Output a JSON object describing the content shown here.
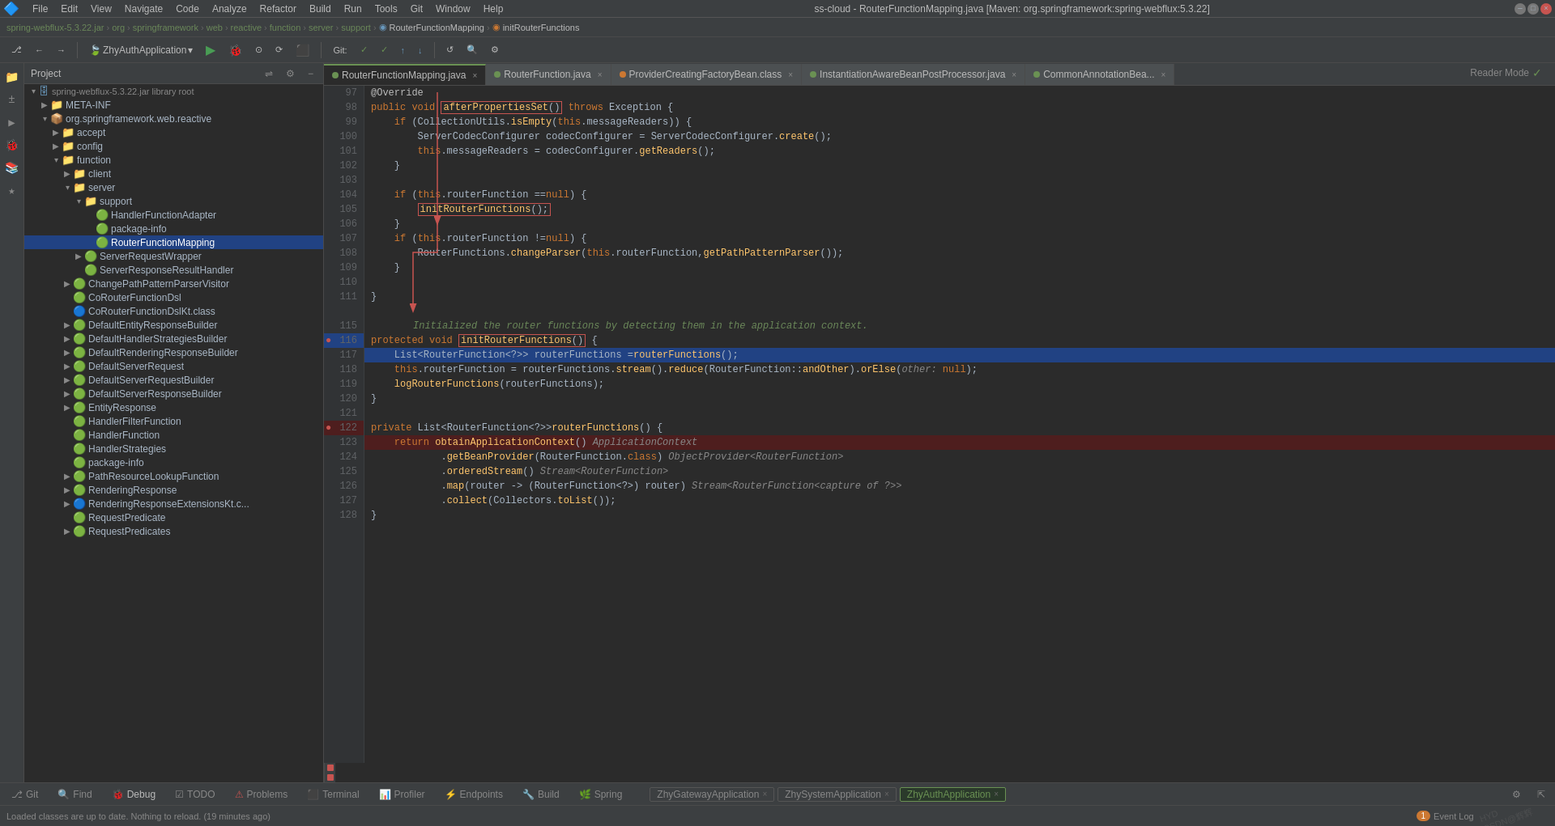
{
  "window": {
    "title": "ss-cloud - RouterFunctionMapping.java [Maven: org.springframework:spring-webflux:5.3.22]",
    "menu_items": [
      "File",
      "Edit",
      "View",
      "Navigate",
      "Code",
      "Analyze",
      "Refactor",
      "Build",
      "Run",
      "Tools",
      "Git",
      "Window",
      "Help"
    ]
  },
  "breadcrumb": {
    "items": [
      "spring-webflux-5.3.22.jar",
      "org",
      "springframework",
      "web",
      "reactive",
      "function",
      "server",
      "support",
      "RouterFunctionMapping",
      "initRouterFunctions"
    ]
  },
  "toolbar": {
    "run_config": "ZhyAuthApplication",
    "git_label": "Git:"
  },
  "project_panel": {
    "title": "Project",
    "tree": [
      {
        "level": 0,
        "label": "spring-webflux-5.3.22.jar library root",
        "type": "lib",
        "expanded": true
      },
      {
        "level": 1,
        "label": "META-INF",
        "type": "folder",
        "expanded": false
      },
      {
        "level": 1,
        "label": "org.springframework.web.reactive",
        "type": "package",
        "expanded": true
      },
      {
        "level": 2,
        "label": "accept",
        "type": "folder",
        "expanded": false
      },
      {
        "level": 2,
        "label": "config",
        "type": "folder",
        "expanded": false
      },
      {
        "level": 2,
        "label": "function",
        "type": "folder",
        "expanded": true
      },
      {
        "level": 3,
        "label": "client",
        "type": "folder",
        "expanded": false
      },
      {
        "level": 3,
        "label": "server",
        "type": "folder",
        "expanded": true
      },
      {
        "level": 4,
        "label": "support",
        "type": "folder",
        "expanded": true
      },
      {
        "level": 5,
        "label": "HandlerFunctionAdapter",
        "type": "java"
      },
      {
        "level": 5,
        "label": "package-info",
        "type": "java"
      },
      {
        "level": 5,
        "label": "RouterFunctionMapping",
        "type": "java",
        "selected": true
      },
      {
        "level": 4,
        "label": "ServerRequestWrapper",
        "type": "java"
      },
      {
        "level": 4,
        "label": "ServerResponseResultHandler",
        "type": "java"
      },
      {
        "level": 3,
        "label": "ChangePathPatternParserVisitor",
        "type": "java"
      },
      {
        "level": 3,
        "label": "CoRouterFunctionDsl",
        "type": "java"
      },
      {
        "level": 3,
        "label": "CoRouterFunctionDslKt.class",
        "type": "class"
      },
      {
        "level": 3,
        "label": "DefaultEntityResponseBuilder",
        "type": "java"
      },
      {
        "level": 3,
        "label": "DefaultHandlerStrategiesBuilder",
        "type": "java"
      },
      {
        "level": 3,
        "label": "DefaultRenderingResponseBuilder",
        "type": "java"
      },
      {
        "level": 3,
        "label": "DefaultServerRequest",
        "type": "java"
      },
      {
        "level": 3,
        "label": "DefaultServerRequestBuilder",
        "type": "java"
      },
      {
        "level": 3,
        "label": "DefaultServerResponseBuilder",
        "type": "java"
      },
      {
        "level": 3,
        "label": "EntityResponse",
        "type": "java"
      },
      {
        "level": 3,
        "label": "HandlerFilterFunction",
        "type": "java"
      },
      {
        "level": 3,
        "label": "HandlerFunction",
        "type": "java"
      },
      {
        "level": 3,
        "label": "HandlerStrategies",
        "type": "java"
      },
      {
        "level": 3,
        "label": "package-info",
        "type": "java"
      },
      {
        "level": 3,
        "label": "PathResourceLookupFunction",
        "type": "java"
      },
      {
        "level": 3,
        "label": "RenderingResponse",
        "type": "java"
      },
      {
        "level": 3,
        "label": "RenderingResponseExtensionsKt.c...",
        "type": "class"
      },
      {
        "level": 3,
        "label": "RequestPredicate",
        "type": "java"
      },
      {
        "level": 3,
        "label": "RequestPredicates",
        "type": "java"
      }
    ]
  },
  "tabs": [
    {
      "label": "RouterFunctionMapping.java",
      "active": true,
      "dot": "green"
    },
    {
      "label": "RouterFunction.java",
      "active": false,
      "dot": "green"
    },
    {
      "label": "ProviderCreatingFactoryBean.class",
      "active": false,
      "dot": "orange"
    },
    {
      "label": "InstantiationAwareBeanPostProcessor.java",
      "active": false,
      "dot": "green"
    },
    {
      "label": "CommonAnnotationBea...",
      "active": false,
      "dot": "green"
    }
  ],
  "code": {
    "reader_mode_label": "Reader Mode",
    "annotation": "@Override",
    "lines": [
      {
        "num": 97,
        "content": "public void afterPropertiesSet() throws Exception {",
        "has_box": true,
        "box_text": "afterPropertiesSet()",
        "breakpoint": false,
        "highlighted": false
      },
      {
        "num": 98,
        "content": "    if (CollectionUtils.isEmpty(this.messageReaders)) {",
        "breakpoint": false,
        "highlighted": false
      },
      {
        "num": 99,
        "content": "        ServerCodecConfigurer codecConfigurer = ServerCodecConfigurer.create();",
        "breakpoint": false,
        "highlighted": false
      },
      {
        "num": 100,
        "content": "        this.messageReaders = codecConfigurer.getReaders();",
        "breakpoint": false,
        "highlighted": false
      },
      {
        "num": 101,
        "content": "    }",
        "breakpoint": false,
        "highlighted": false
      },
      {
        "num": 102,
        "content": "",
        "breakpoint": false,
        "highlighted": false
      },
      {
        "num": 103,
        "content": "    if (this.routerFunction == null) {",
        "breakpoint": false,
        "highlighted": false
      },
      {
        "num": 104,
        "content": "        initRouterFunctions();",
        "has_box": true,
        "box_text": "initRouterFunctions();",
        "breakpoint": false,
        "highlighted": false
      },
      {
        "num": 105,
        "content": "    }",
        "breakpoint": false,
        "highlighted": false
      },
      {
        "num": 106,
        "content": "    if (this.routerFunction != null) {",
        "breakpoint": false,
        "highlighted": false
      },
      {
        "num": 107,
        "content": "        RouterFunctions.changeParser(this.routerFunction, getPathPatternParser());",
        "breakpoint": false,
        "highlighted": false
      },
      {
        "num": 108,
        "content": "    }",
        "breakpoint": false,
        "highlighted": false
      },
      {
        "num": 109,
        "content": "",
        "breakpoint": false,
        "highlighted": false
      },
      {
        "num": 110,
        "content": "}",
        "breakpoint": false,
        "highlighted": false
      },
      {
        "num": 111,
        "content": "",
        "breakpoint": false,
        "highlighted": false
      },
      {
        "num": "",
        "content": "    Initialized the router functions by detecting them in the application context.",
        "is_comment": true
      },
      {
        "num": 115,
        "content": "protected void initRouterFunctions() {",
        "has_box": true,
        "box_text": "initRouterFunctions()",
        "breakpoint": false,
        "highlighted": false
      },
      {
        "num": 116,
        "content": "    List<RouterFunction<?>> routerFunctions = routerFunctions();",
        "breakpoint": true,
        "highlighted": true
      },
      {
        "num": 117,
        "content": "    this.routerFunction = routerFunctions.stream().reduce(RouterFunction::andOther).orElse( other: null);",
        "breakpoint": false,
        "highlighted": false
      },
      {
        "num": 118,
        "content": "    logRouterFunctions(routerFunctions);",
        "breakpoint": false,
        "highlighted": false
      },
      {
        "num": 119,
        "content": "}",
        "breakpoint": false,
        "highlighted": false
      },
      {
        "num": 120,
        "content": "",
        "breakpoint": false,
        "highlighted": false
      },
      {
        "num": 121,
        "content": "private List<RouterFunction<?>> routerFunctions() {",
        "breakpoint": false,
        "highlighted": false
      },
      {
        "num": 122,
        "content": "    return obtainApplicationContext()  ApplicationContext",
        "breakpoint": true,
        "highlighted": false,
        "error": true
      },
      {
        "num": 123,
        "content": "            .getBeanProvider(RouterFunction.class)  ObjectProvider<RouterFunction>",
        "breakpoint": false,
        "highlighted": false
      },
      {
        "num": 124,
        "content": "            .orderedStream()  Stream<RouterFunction>",
        "breakpoint": false,
        "highlighted": false
      },
      {
        "num": 125,
        "content": "            .map(router -> (RouterFunction<?>) router)  Stream<RouterFunction<capture of ?>>",
        "breakpoint": false,
        "highlighted": false
      },
      {
        "num": 126,
        "content": "            .collect(Collectors.toList());",
        "breakpoint": false,
        "highlighted": false
      },
      {
        "num": 127,
        "content": "}",
        "breakpoint": false,
        "highlighted": false
      },
      {
        "num": 128,
        "content": "",
        "breakpoint": false,
        "highlighted": false
      }
    ]
  },
  "debug_bar": {
    "tabs": [
      {
        "label": "Git",
        "icon": "git"
      },
      {
        "label": "Find",
        "icon": "find"
      },
      {
        "label": "Debug",
        "icon": "debug",
        "active": true,
        "dot": "orange"
      },
      {
        "label": "TODO",
        "icon": "todo"
      },
      {
        "label": "Problems",
        "icon": "problems",
        "dot": "orange"
      },
      {
        "label": "Terminal",
        "icon": "terminal"
      },
      {
        "label": "Profiler",
        "icon": "profiler"
      },
      {
        "label": "Endpoints",
        "icon": "endpoints"
      },
      {
        "label": "Build",
        "icon": "build"
      },
      {
        "label": "Spring",
        "icon": "spring"
      }
    ],
    "debug_sessions": [
      {
        "label": "ZhyGatewayApplication",
        "active": false
      },
      {
        "label": "ZhySystemApplication",
        "active": false
      },
      {
        "label": "ZhyAuthApplication",
        "active": true
      }
    ]
  },
  "status_bar": {
    "text": "Loaded classes are up to date. Nothing to reload. (19 minutes ago)",
    "event_log_badge": "1",
    "event_log_label": "Event Log",
    "watermark": "HYD\nCSDN@辉辉"
  }
}
